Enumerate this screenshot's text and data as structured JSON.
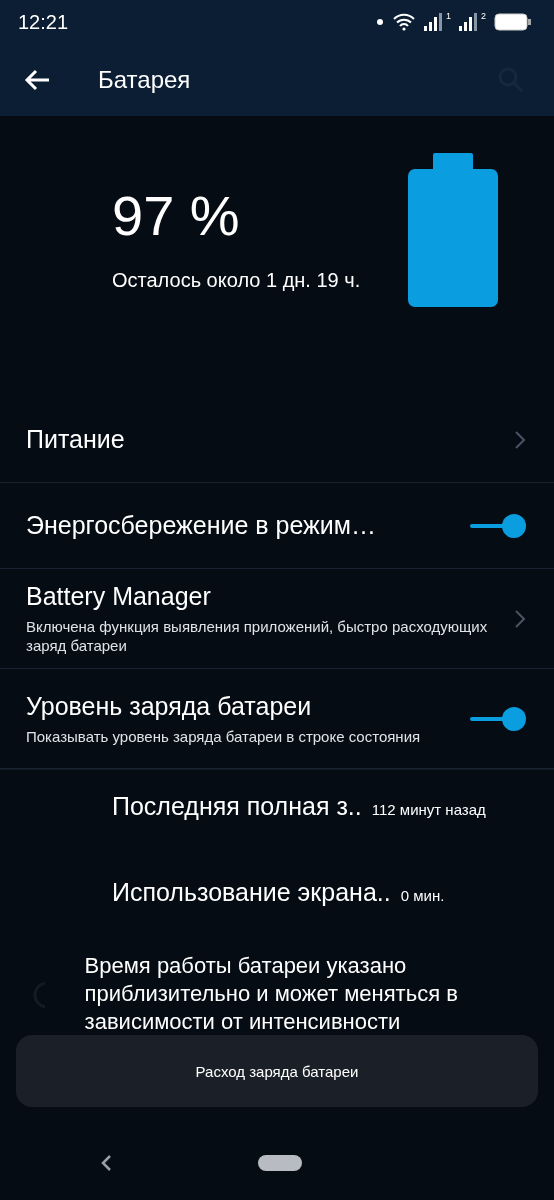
{
  "status_bar": {
    "time": "12:21",
    "sim_labels": [
      "1",
      "2"
    ]
  },
  "app_bar": {
    "title": "Батарея"
  },
  "battery": {
    "percent": "97 %",
    "estimate": "Осталось около 1 дн. 19 ч."
  },
  "settings": [
    {
      "kind": "link",
      "title": "Питание"
    },
    {
      "kind": "toggle",
      "title": "Энергосбережение в режим…",
      "on": true
    },
    {
      "kind": "link",
      "title": "Battery Manager",
      "subtitle": "Включена функция выявления приложений, быстро расходующих заряд батареи"
    },
    {
      "kind": "toggle",
      "title": "Уровень заряда батареи",
      "subtitle": "Показывать уровень заряда батареи в строке состояния",
      "on": true
    }
  ],
  "stats": [
    {
      "label": "Последняя полная з..",
      "value": "112 минут назад"
    },
    {
      "label": "Использование экрана..",
      "value": "0 мин."
    }
  ],
  "info_text": "Время работы батареи указано приблизительно и может меняться в зависимости от интенсивности",
  "toast": "Расход заряда батареи"
}
